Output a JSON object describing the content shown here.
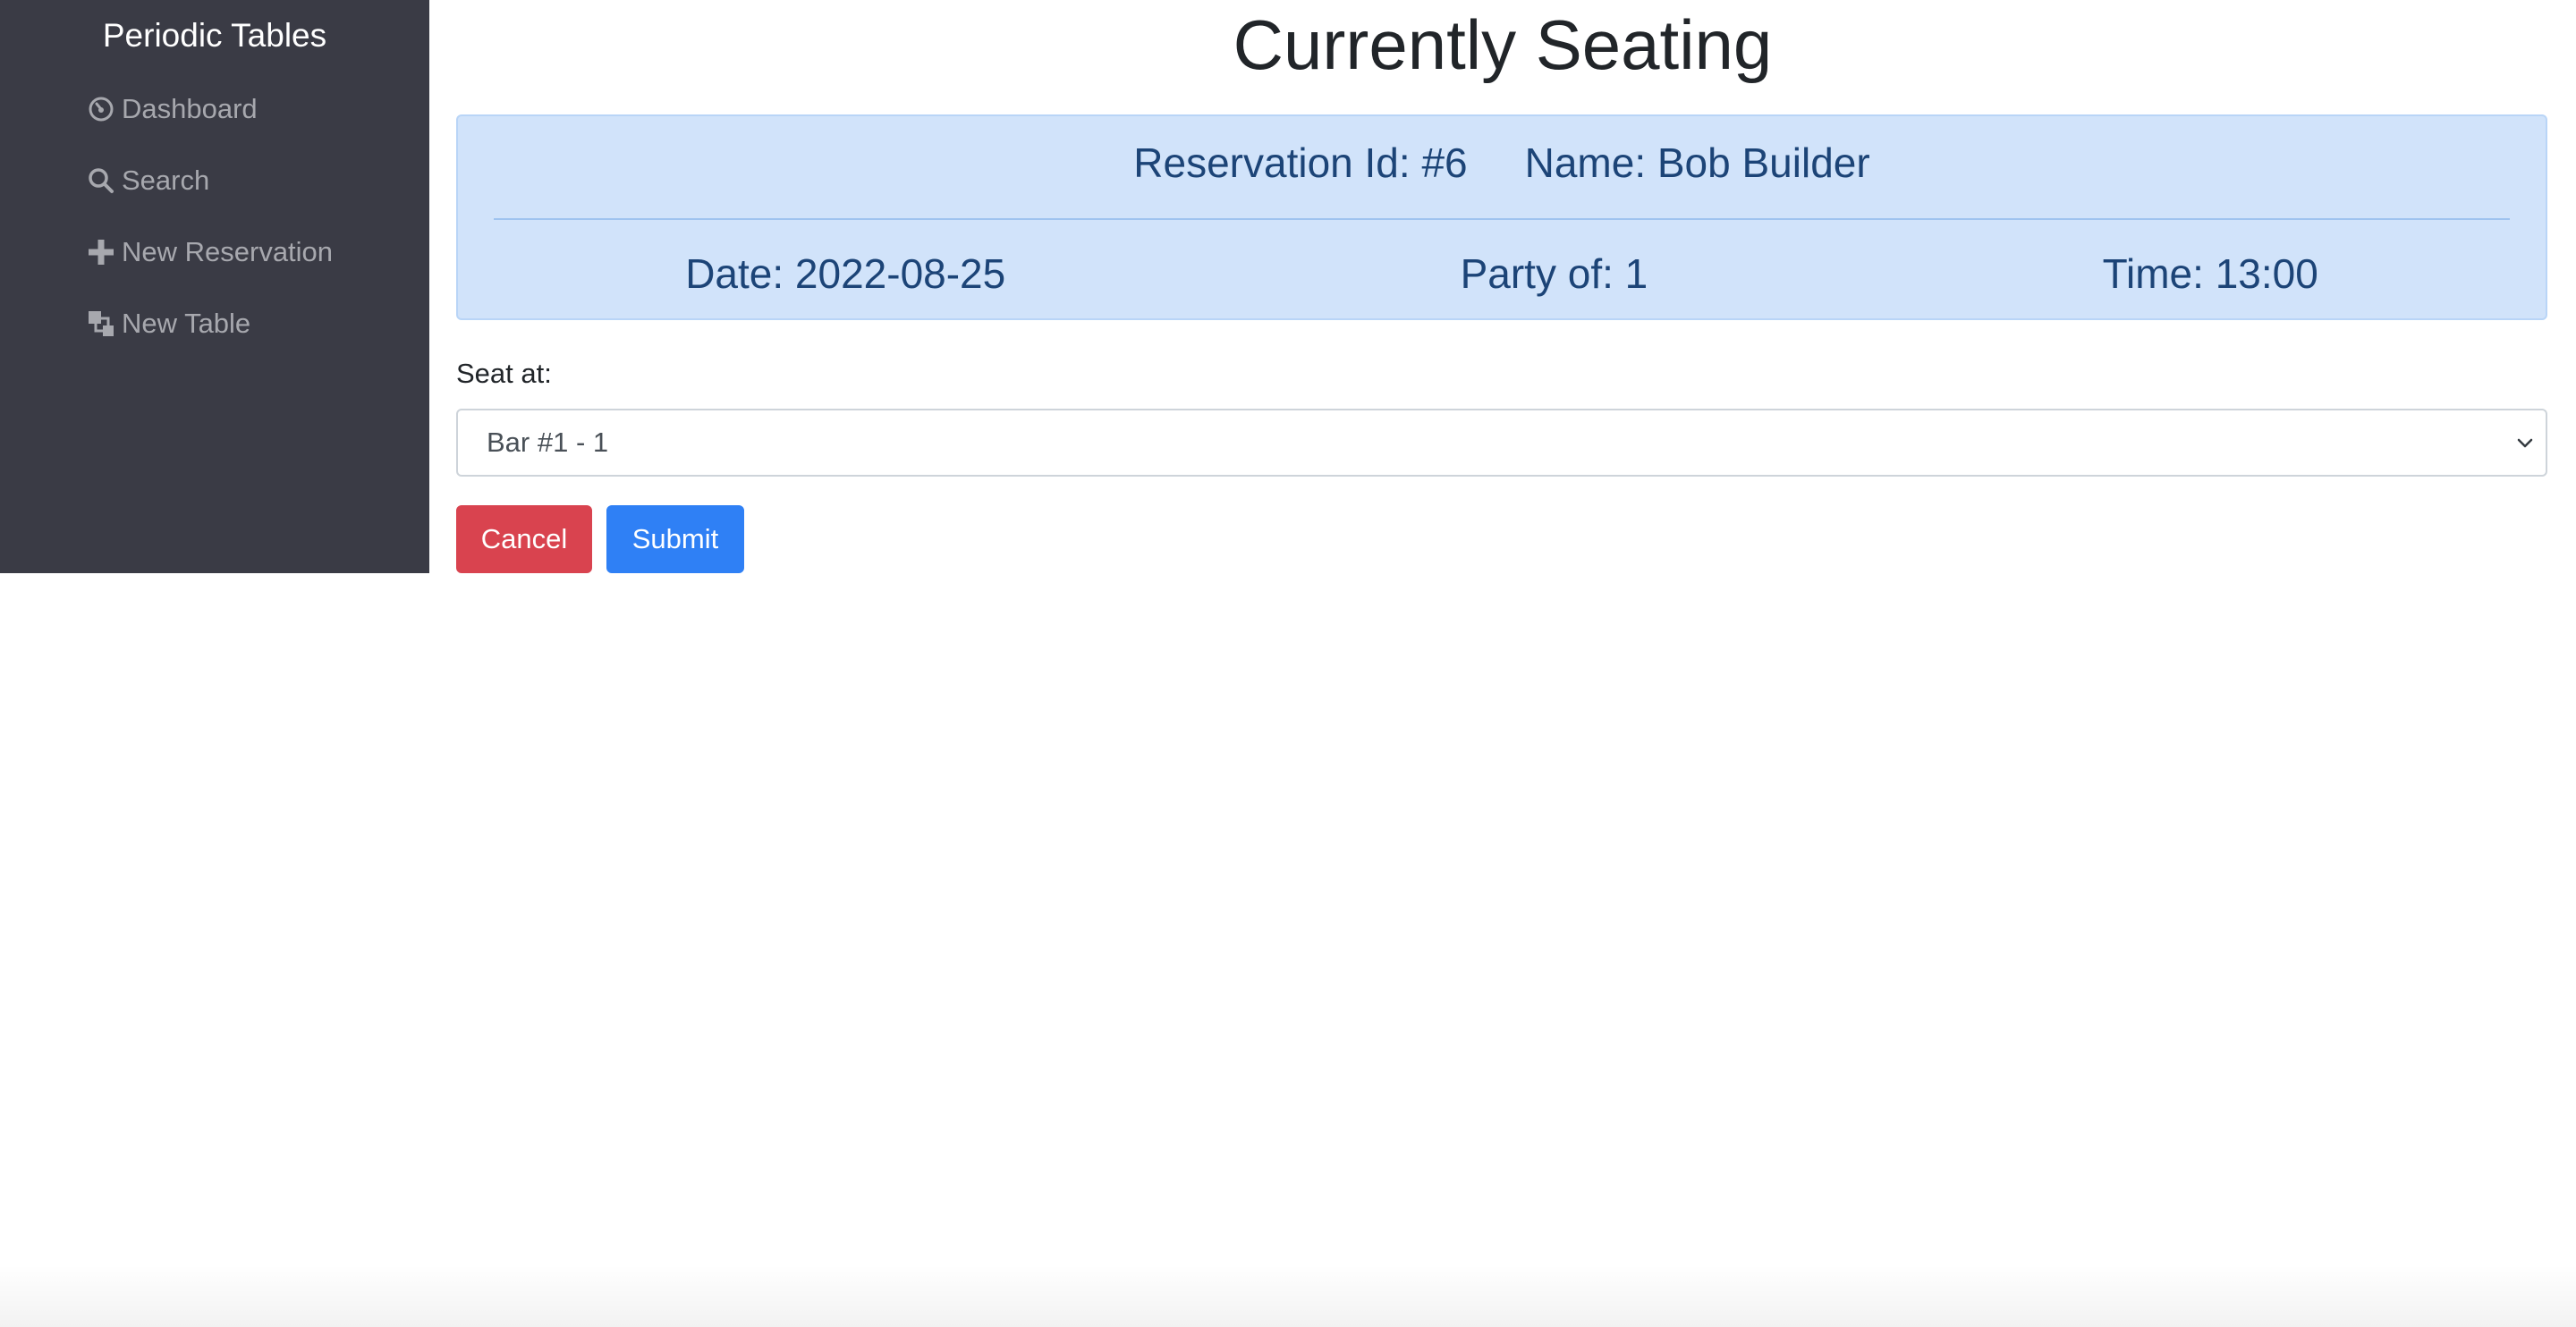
{
  "sidebar": {
    "brand": "Periodic Tables",
    "items": [
      {
        "label": "Dashboard",
        "icon": "dashboard-icon"
      },
      {
        "label": "Search",
        "icon": "search-icon"
      },
      {
        "label": "New Reservation",
        "icon": "plus-icon"
      },
      {
        "label": "New Table",
        "icon": "table-icon"
      }
    ]
  },
  "main": {
    "title": "Currently Seating",
    "reservation": {
      "id_text": "Reservation Id: #6",
      "name_text": "Name: Bob Builder",
      "date_text": "Date: 2022-08-25",
      "party_text": "Party of: 1",
      "time_text": "Time: 13:00"
    },
    "seat_label": "Seat at:",
    "seat_select": {
      "selected": "Bar #1 - 1"
    },
    "buttons": {
      "cancel": "Cancel",
      "submit": "Submit"
    }
  },
  "colors": {
    "sidebar_bg": "#3a3b45",
    "card_bg": "#d1e3fa",
    "card_text": "#1c4477",
    "cancel": "#d9434f",
    "submit": "#2f80f5"
  }
}
